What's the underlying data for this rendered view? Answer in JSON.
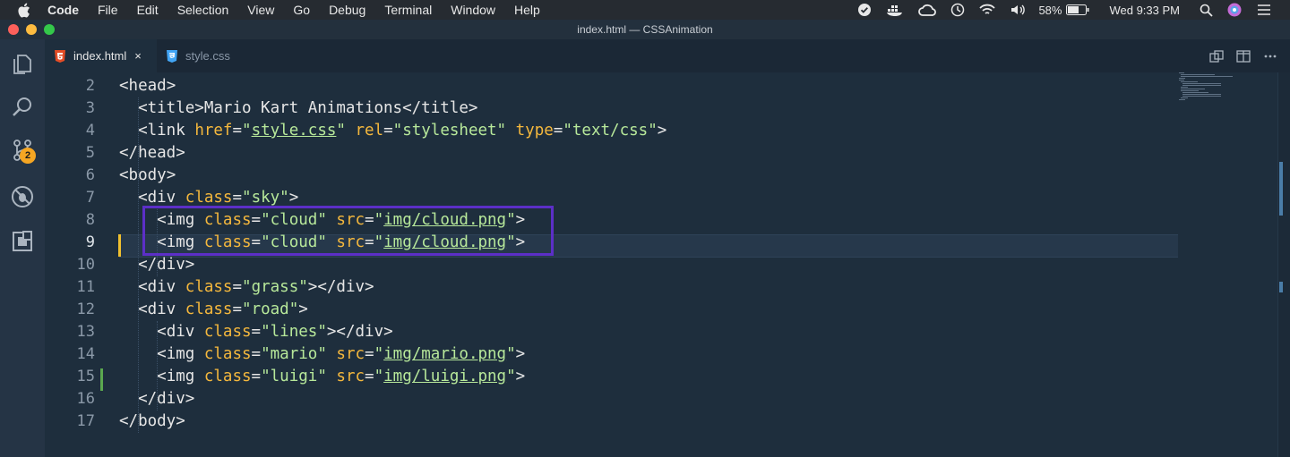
{
  "menubar": {
    "items": [
      "Code",
      "File",
      "Edit",
      "Selection",
      "View",
      "Go",
      "Debug",
      "Terminal",
      "Window",
      "Help"
    ],
    "battery": "58%",
    "clock": "Wed 9:33 PM"
  },
  "window": {
    "title": "index.html — CSSAnimation"
  },
  "activity": {
    "scm_badge": "2"
  },
  "tabs": [
    {
      "label": "index.html",
      "icon": "html5-icon",
      "close": "×"
    },
    {
      "label": "style.css",
      "icon": "css3-icon"
    }
  ],
  "editor": {
    "lines": [
      {
        "n": "2",
        "c": "<head>"
      },
      {
        "n": "3",
        "c": "  <title>Mario Kart Animations</title>"
      },
      {
        "n": "4",
        "c": "  <link href=\"style.css\" rel=\"stylesheet\" type=\"text/css\">"
      },
      {
        "n": "5",
        "c": "</head>"
      },
      {
        "n": "6",
        "c": "<body>"
      },
      {
        "n": "7",
        "c": "  <div class=\"sky\">"
      },
      {
        "n": "8",
        "c": "    <img class=\"cloud\" src=\"img/cloud.png\">"
      },
      {
        "n": "9",
        "c": "    <img class=\"cloud\" src=\"img/cloud.png\">"
      },
      {
        "n": "10",
        "c": "  </div>"
      },
      {
        "n": "11",
        "c": "  <div class=\"grass\"></div>"
      },
      {
        "n": "12",
        "c": "  <div class=\"road\">"
      },
      {
        "n": "13",
        "c": "    <div class=\"lines\"></div>"
      },
      {
        "n": "14",
        "c": "    <img class=\"mario\" src=\"img/mario.png\">"
      },
      {
        "n": "15",
        "c": "    <img class=\"luigi\" src=\"img/luigi.png\">"
      },
      {
        "n": "16",
        "c": "  </div>"
      },
      {
        "n": "17",
        "c": "</body>"
      }
    ],
    "current_line": "9"
  },
  "colors": {
    "tag": "#e6e6e6",
    "attr": "#f5b83d",
    "string": "#b7e89a",
    "highlight_box": "#5c2fc7",
    "modified_gutter": "#f0c02f",
    "added_gutter": "#5ba84f"
  }
}
